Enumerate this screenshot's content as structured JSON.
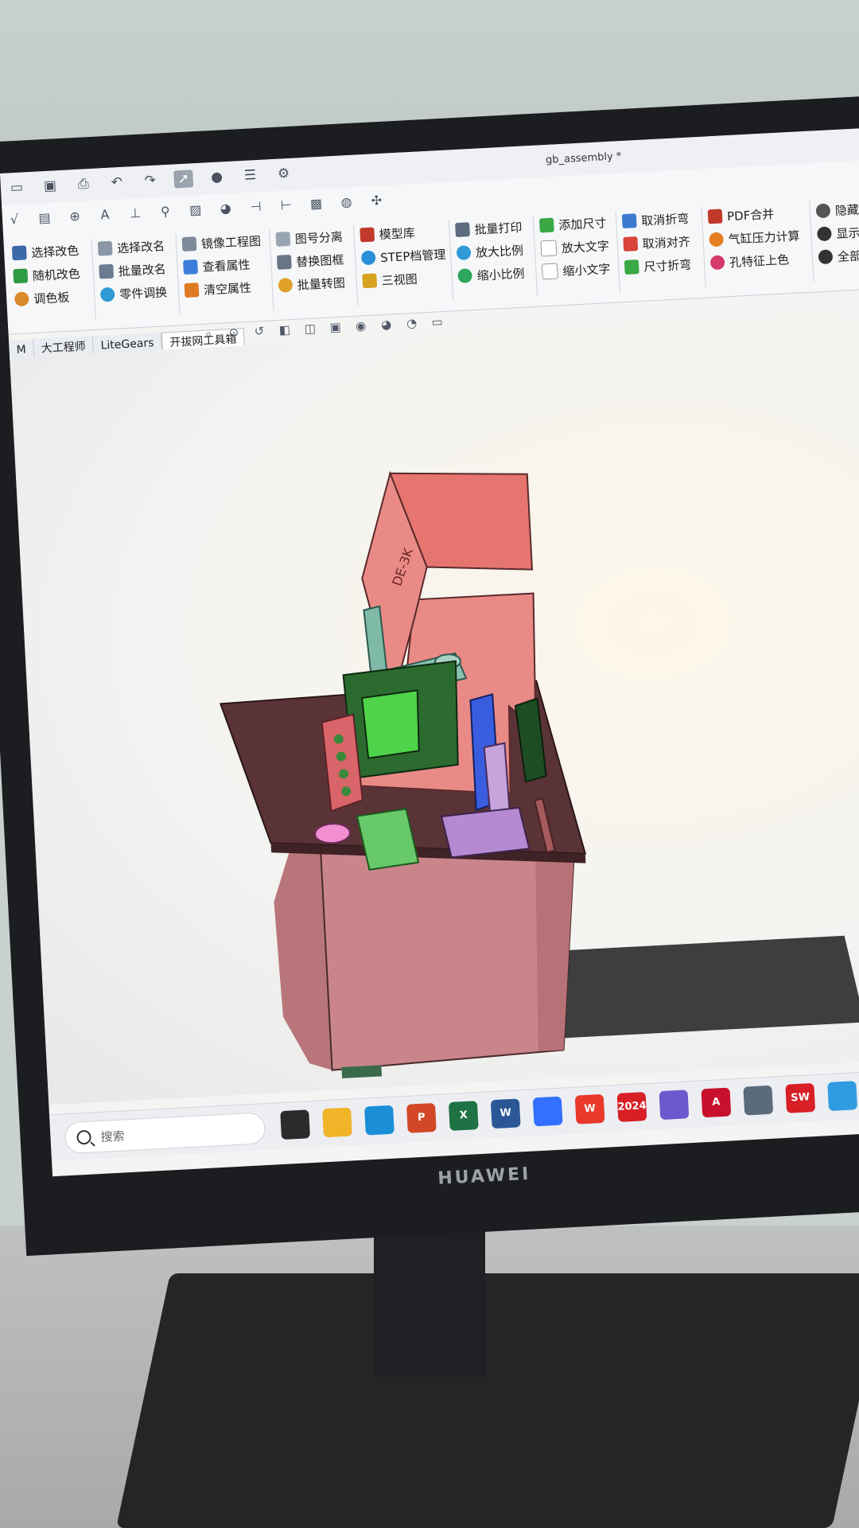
{
  "window": {
    "title": "gb_assembly *"
  },
  "ribbon": {
    "groups": [
      {
        "items": [
          "选择改色",
          "随机改色",
          "调色板"
        ]
      },
      {
        "items": [
          "选择改名",
          "批量改名",
          "零件调换"
        ]
      },
      {
        "items": [
          "镜像工程图",
          "查看属性",
          "清空属性"
        ]
      },
      {
        "items": [
          "图号分离",
          "替换图框",
          "批量转图"
        ]
      },
      {
        "items": [
          "模型库",
          "STEP档管理",
          "三视图"
        ]
      },
      {
        "items": [
          "批量打印",
          "放大比例",
          "缩小比例"
        ]
      },
      {
        "items": [
          "添加尺寸",
          "放大文字",
          "缩小文字"
        ]
      },
      {
        "items": [
          "取消折弯",
          "取消对齐",
          "尺寸折弯"
        ]
      },
      {
        "items": [
          "PDF合并",
          "气缸压力计算",
          "孔特征上色"
        ]
      },
      {
        "items": [
          "隐藏",
          "显示",
          "全部"
        ]
      }
    ],
    "tabs": [
      "M",
      "大工程师",
      "LiteGears",
      "开拔网工具箱"
    ]
  },
  "taskbar": {
    "search_placeholder": "搜索",
    "apps": [
      {
        "name": "task-view",
        "label": "",
        "color": "#2b2b2b"
      },
      {
        "name": "file-explorer",
        "label": "",
        "color": "#f0b429"
      },
      {
        "name": "edge",
        "label": "",
        "color": "#1a8fd8"
      },
      {
        "name": "powerpoint",
        "label": "P",
        "color": "#d24726"
      },
      {
        "name": "excel",
        "label": "X",
        "color": "#1f7244"
      },
      {
        "name": "word",
        "label": "W",
        "color": "#2b5797"
      },
      {
        "name": "feishu",
        "label": "",
        "color": "#3370ff"
      },
      {
        "name": "wps",
        "label": "W",
        "color": "#e8392c"
      },
      {
        "name": "solidworks-2024",
        "label": "2024",
        "color": "#d81f26"
      },
      {
        "name": "installer",
        "label": "",
        "color": "#6a5acd"
      },
      {
        "name": "autocad",
        "label": "A",
        "color": "#c8102e"
      },
      {
        "name": "settings",
        "label": "",
        "color": "#5a6b7b"
      },
      {
        "name": "solidworks",
        "label": "SW",
        "color": "#d81f26"
      },
      {
        "name": "browser",
        "label": "",
        "color": "#2f9be0"
      },
      {
        "name": "wechat",
        "label": "",
        "color": "#2ab83b"
      }
    ]
  },
  "monitor": {
    "brand": "HUAWEI"
  },
  "model": {
    "nameplate": "DE-3K"
  }
}
